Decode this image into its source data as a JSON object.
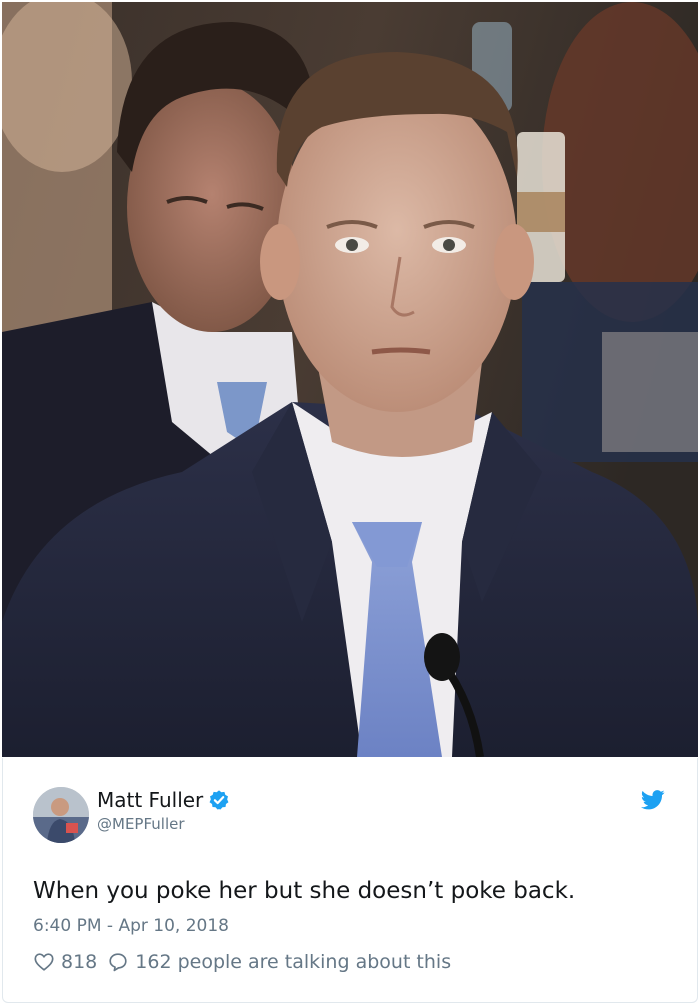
{
  "tweet": {
    "author": {
      "display_name": "Matt Fuller",
      "handle": "@MEPFuller",
      "verified": true
    },
    "text": "When you poke her but she doesn’t poke back.",
    "timestamp": "6:40 PM - Apr 10, 2018",
    "likes": "818",
    "replies_summary": "162 people are talking about this"
  },
  "colors": {
    "text_primary": "#14171a",
    "text_secondary": "#657786",
    "twitter_blue": "#1da1f2",
    "border": "#e1e8ed"
  },
  "icons": {
    "verified": "verified-badge-icon",
    "platform": "twitter-bird-icon",
    "like": "heart-icon",
    "reply": "speech-bubble-icon"
  }
}
